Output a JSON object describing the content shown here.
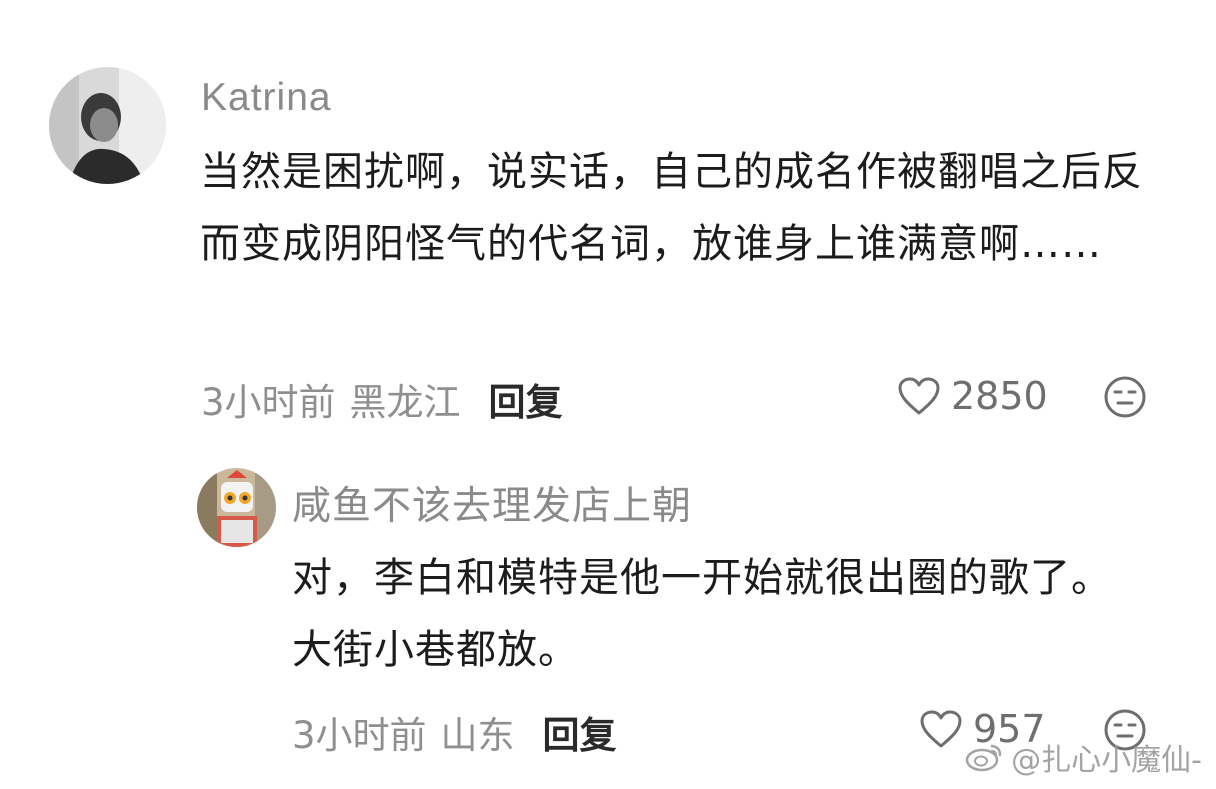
{
  "comments": [
    {
      "username": "Katrina",
      "text": "当然是困扰啊，说实话，自己的成名作被翻唱之后反而变成阴阳怪气的代名词，放谁身上谁满意啊……",
      "time": "3小时前",
      "location": "黑龙江",
      "reply_label": "回复",
      "likes": "2850",
      "icons": {
        "like": "heart-outline-icon",
        "reaction": "neutral-face-icon"
      }
    },
    {
      "username": "咸鱼不该去理发店上朝",
      "text": "对，李白和模特是他一开始就很出圈的歌了。大街小巷都放。",
      "time": "3小时前",
      "location": "山东",
      "reply_label": "回复",
      "likes": "957",
      "icons": {
        "like": "heart-outline-icon",
        "reaction": "neutral-face-icon"
      }
    }
  ],
  "watermark": "@扎心小魔仙-",
  "colors": {
    "username": "#8a8a8a",
    "meta": "#8f8f8f",
    "text": "#1c1c1c",
    "icon": "#6e6e6e"
  }
}
